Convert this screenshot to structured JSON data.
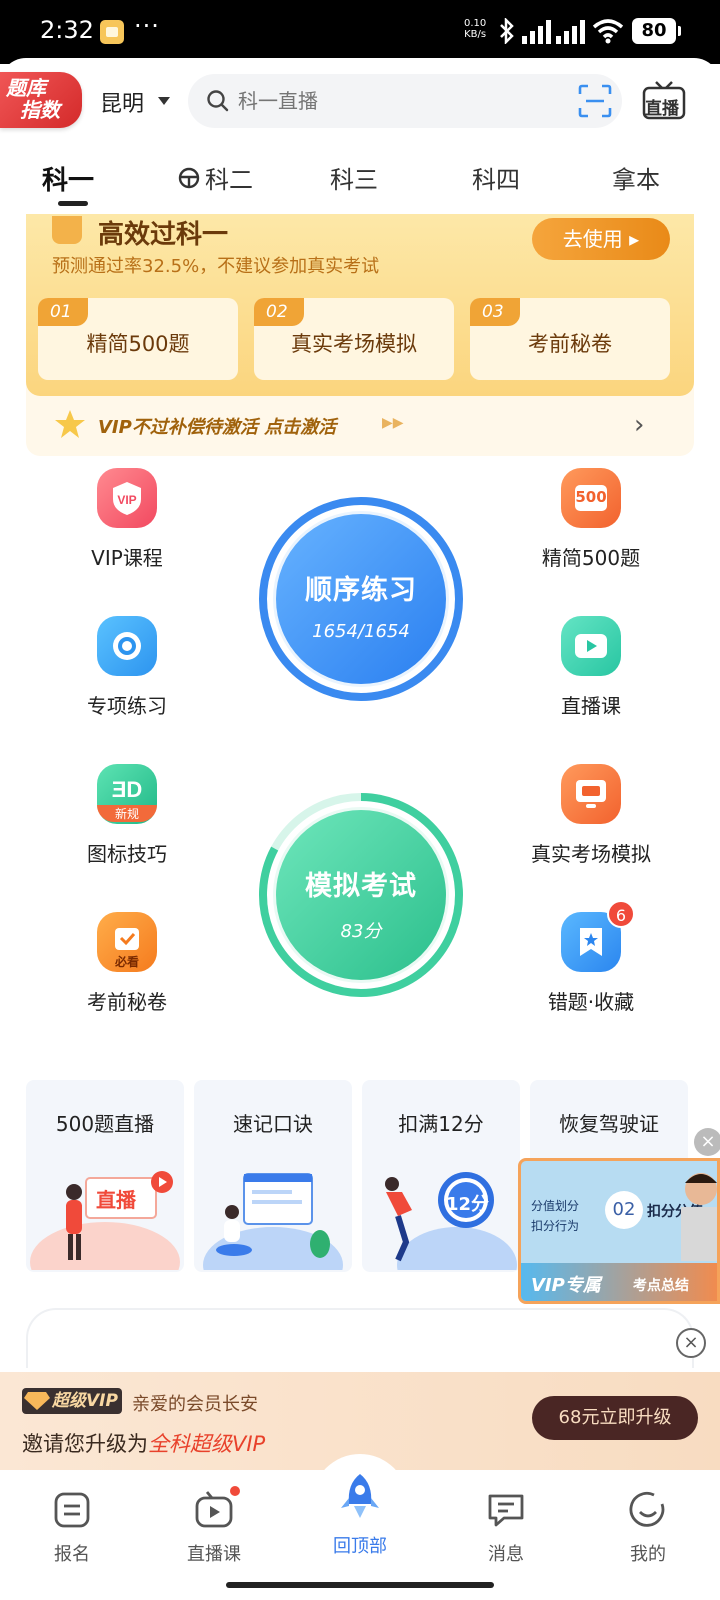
{
  "status_bar": {
    "time": "2:32",
    "more": "···",
    "net_speed_top": "0.10",
    "net_speed_bottom": "KB/s",
    "battery": "80"
  },
  "header": {
    "badge": {
      "line1": "题库",
      "line2": "指数"
    },
    "city": "昆明",
    "search_placeholder": "科一直播",
    "live_label": "直播"
  },
  "tabs": [
    {
      "label": "科一",
      "active": true
    },
    {
      "label": "科二"
    },
    {
      "label": "科三"
    },
    {
      "label": "科四"
    },
    {
      "label": "拿本"
    }
  ],
  "vip_card": {
    "title": "高效过科一",
    "subtitle": "预测通过率32.5%，不建议参加真实考试",
    "use_button": "去使用 ▸",
    "options": [
      {
        "num": "01",
        "label": "精简500题"
      },
      {
        "num": "02",
        "label": "真实考场模拟"
      },
      {
        "num": "03",
        "label": "考前秘卷"
      }
    ],
    "promo": "VIP不过补偿待激活 点击激活",
    "promo_arrows": "▶▶",
    "chevron": "›"
  },
  "features_left": [
    {
      "name": "VIP课程",
      "icon": "vip-course-icon"
    },
    {
      "name": "专项练习",
      "icon": "target-icon"
    },
    {
      "name": "图标技巧",
      "icon": "icon-tips-icon",
      "tag": "新规"
    },
    {
      "name": "考前秘卷",
      "icon": "secret-paper-icon",
      "tag": "必看"
    }
  ],
  "features_right": [
    {
      "name": "精简500题",
      "icon": "500-icon",
      "tag": "500"
    },
    {
      "name": "直播课",
      "icon": "live-video-icon"
    },
    {
      "name": "真实考场模拟",
      "icon": "monitor-icon"
    },
    {
      "name": "错题·收藏",
      "icon": "bookmark-icon",
      "badge": "6"
    }
  ],
  "practice": {
    "title": "顺序练习",
    "progress": "1654/1654"
  },
  "exam": {
    "title": "模拟考试",
    "score": "83分"
  },
  "cards": [
    {
      "title": "500题直播",
      "tag": "直播"
    },
    {
      "title": "速记口诀"
    },
    {
      "title": "扣满12分",
      "tag": "12分"
    },
    {
      "title": "恢复驾驶证"
    }
  ],
  "float_video": {
    "close": "×",
    "line1": "分值划分",
    "line2": "扣分行为",
    "num": "02",
    "tag": "扣分分值",
    "vip": "VIP专属",
    "summary": "考点总结"
  },
  "banner": {
    "super_vip": "超级VIP",
    "greeting": "亲爱的会员长安",
    "invite_prefix": "邀请您升级为",
    "invite_highlight": "全科超级VIP",
    "upgrade_btn": "68元立即升级",
    "close": "×"
  },
  "bottom_nav": [
    {
      "label": "报名"
    },
    {
      "label": "直播课"
    },
    {
      "label": "回顶部",
      "active": true
    },
    {
      "label": "消息"
    },
    {
      "label": "我的"
    }
  ],
  "colors": {
    "accent_blue": "#3a7bea",
    "vip_gold": "#f0a436",
    "teal": "#3fcf9f",
    "red": "#f04a3a"
  }
}
